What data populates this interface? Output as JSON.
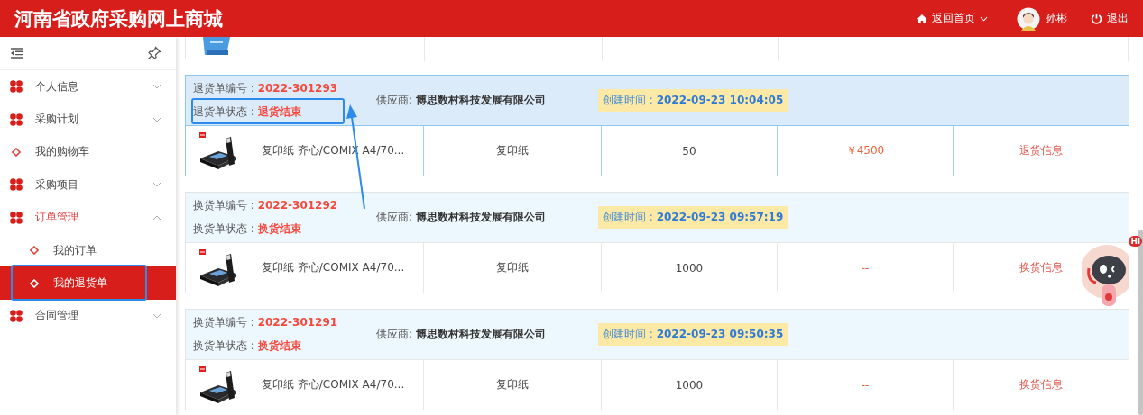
{
  "header": {
    "title": "河南省政府采购网上商城",
    "home_link": "返回首页",
    "user_name": "孙彬",
    "logout": "退出"
  },
  "sidebar": {
    "items": [
      {
        "label": "个人信息",
        "kind": "group",
        "expanded": false,
        "selected": false,
        "highlighted": false
      },
      {
        "label": "采购计划",
        "kind": "group",
        "expanded": false,
        "selected": false,
        "highlighted": false
      },
      {
        "label": "我的购物车",
        "kind": "link",
        "selected": false,
        "highlighted": false
      },
      {
        "label": "采购项目",
        "kind": "group",
        "expanded": false,
        "selected": false,
        "highlighted": false
      },
      {
        "label": "订单管理",
        "kind": "group",
        "expanded": true,
        "selected": false,
        "highlighted": false,
        "children": [
          {
            "label": "我的订单",
            "kind": "link",
            "selected": false,
            "highlighted": false
          },
          {
            "label": "我的退货单",
            "kind": "link",
            "selected": true,
            "highlighted": true
          }
        ]
      },
      {
        "label": "合同管理",
        "kind": "group",
        "expanded": false,
        "selected": false,
        "highlighted": false
      }
    ]
  },
  "cards": [
    {
      "selected": true,
      "number": "退货单编号 : **2022-301293**",
      "status": "退货单状态 : **退货结束**",
      "status_highlighted": true,
      "supplier": "供应商: **博思数村科技发展有限公司**",
      "created": "创建时间 : **2022-09-23 10:04:05**",
      "item": {
        "name": "复印纸 齐心/COMIX A4/70...",
        "type": "复印纸",
        "quantity": "50",
        "price": "￥4500",
        "action": "退货信息"
      }
    },
    {
      "selected": false,
      "number": "换货单编号 : **2022-301292**",
      "status": "换货单状态 : **换货结束**",
      "status_highlighted": false,
      "supplier": "供应商: **博思数村科技发展有限公司**",
      "created": "创建时间 : **2022-09-23 09:57:19**",
      "item": {
        "name": "复印纸 齐心/COMIX A4/70...",
        "type": "复印纸",
        "quantity": "1000",
        "price": "--",
        "action": "换货信息"
      }
    },
    {
      "selected": false,
      "number": "换货单编号 : **2022-301291**",
      "status": "换货单状态 : **换货结束**",
      "status_highlighted": false,
      "supplier": "供应商: **博思数村科技发展有限公司**",
      "created": "创建时间 : **2022-09-23 09:50:35**",
      "item": {
        "name": "复印纸 齐心/COMIX A4/70...",
        "type": "复印纸",
        "quantity": "1000",
        "price": "--",
        "action": "换货信息"
      }
    }
  ],
  "assistant": {
    "badge": "Hi"
  }
}
